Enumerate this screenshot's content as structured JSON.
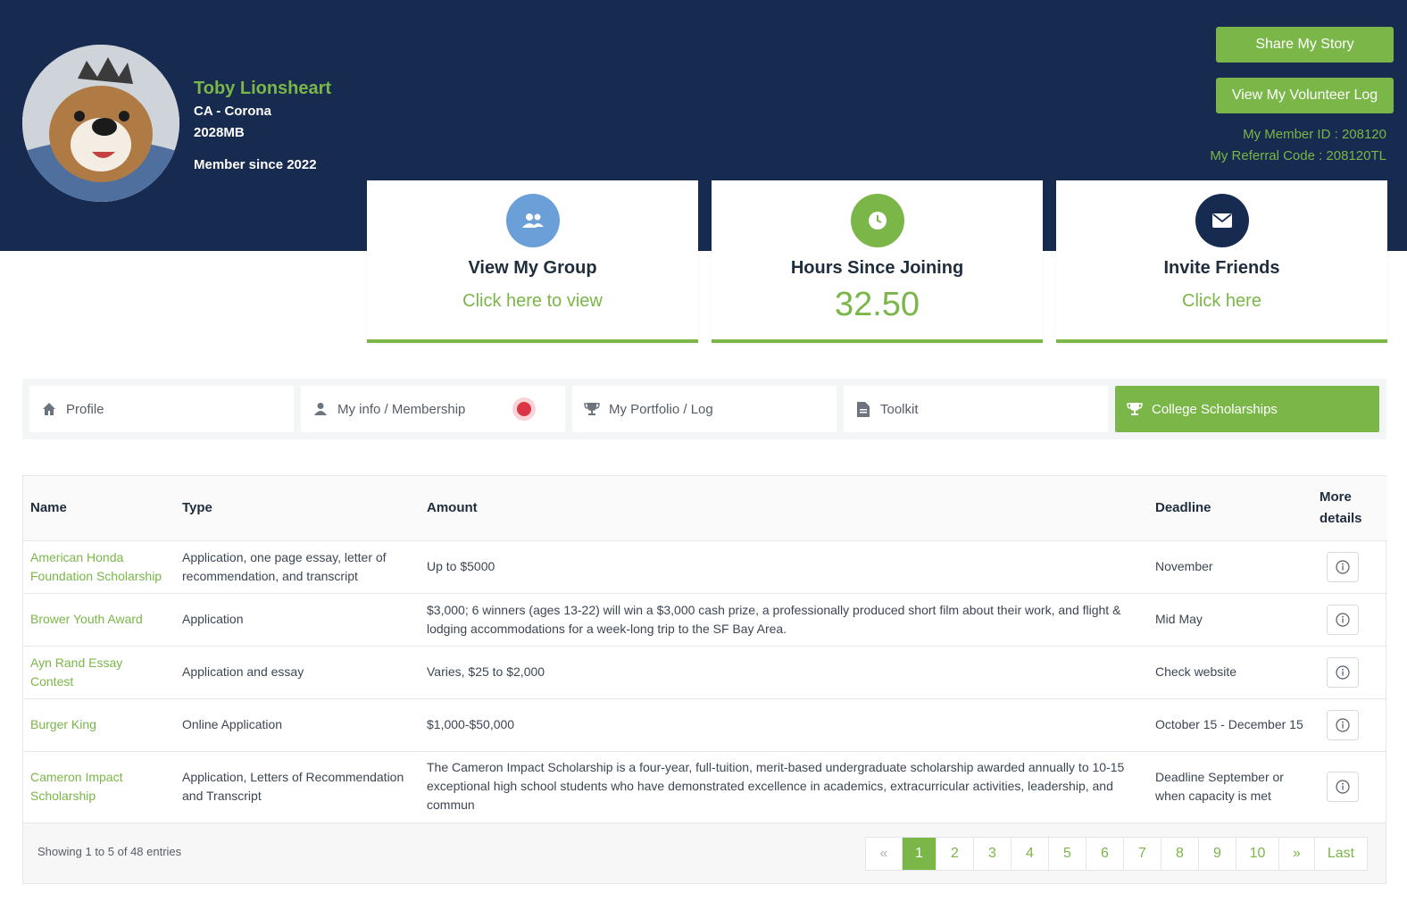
{
  "profile": {
    "name": "Toby Lionsheart",
    "location": "CA - Corona",
    "code": "2028MB",
    "member_since": "Member since 2022"
  },
  "actions": {
    "share_story": "Share My Story",
    "view_log": "View My Volunteer Log",
    "member_id": "My Member ID : 208120",
    "referral_code": "My Referral Code : 208120TL"
  },
  "cards": [
    {
      "title": "View My Group",
      "subtitle": "Click here to view",
      "icon": "group-icon",
      "color": "#6a9fd8"
    },
    {
      "title": "Hours Since Joining",
      "value": "32.50",
      "icon": "clock-icon",
      "color": "#7ab648"
    },
    {
      "title": "Invite Friends",
      "subtitle": "Click here",
      "icon": "envelope-icon",
      "color": "#172a4f"
    }
  ],
  "tabs": [
    {
      "label": "Profile",
      "icon": "home-icon"
    },
    {
      "label": "My info / Membership",
      "icon": "user-icon"
    },
    {
      "label": "My Portfolio / Log",
      "icon": "trophy-icon"
    },
    {
      "label": "Toolkit",
      "icon": "document-icon"
    },
    {
      "label": "College Scholarships",
      "icon": "trophy-icon",
      "active": true
    }
  ],
  "table": {
    "headers": {
      "name": "Name",
      "type": "Type",
      "amount": "Amount",
      "deadline": "Deadline",
      "more": "More details"
    },
    "rows": [
      {
        "name": "American Honda Foundation Scholarship",
        "type": "Application, one page essay, letter of recommendation, and transcript",
        "amount": "Up to $5000",
        "deadline": "November"
      },
      {
        "name": "Brower Youth Award",
        "type": "Application",
        "amount": "$3,000; 6 winners (ages 13-22) will win a $3,000 cash prize, a professionally produced short film about their work, and flight & lodging accommodations for a week-long trip to the SF Bay Area.",
        "deadline": "Mid May"
      },
      {
        "name": "Ayn Rand Essay Contest",
        "type": "Application and essay",
        "amount": "Varies, $25 to $2,000",
        "deadline": "Check website"
      },
      {
        "name": "Burger King",
        "type": "Online Application",
        "amount": "$1,000-$50,000",
        "deadline": "October 15 - December 15"
      },
      {
        "name": "Cameron Impact Scholarship",
        "type": "Application, Letters of Recommendation and Transcript",
        "amount": "The Cameron Impact Scholarship is a four-year, full-tuition, merit-based undergraduate scholarship awarded annually to 10-15 exceptional high school students who have demonstrated excellence in academics, extracurricular activities, leadership, and commun",
        "deadline": "Deadline September or when capacity is met"
      }
    ],
    "showing": "Showing 1 to 5 of 48 entries"
  },
  "pagination": {
    "prev": "«",
    "pages": [
      "1",
      "2",
      "3",
      "4",
      "5",
      "6",
      "7",
      "8",
      "9",
      "10"
    ],
    "next": "»",
    "last": "Last",
    "current": "1"
  }
}
